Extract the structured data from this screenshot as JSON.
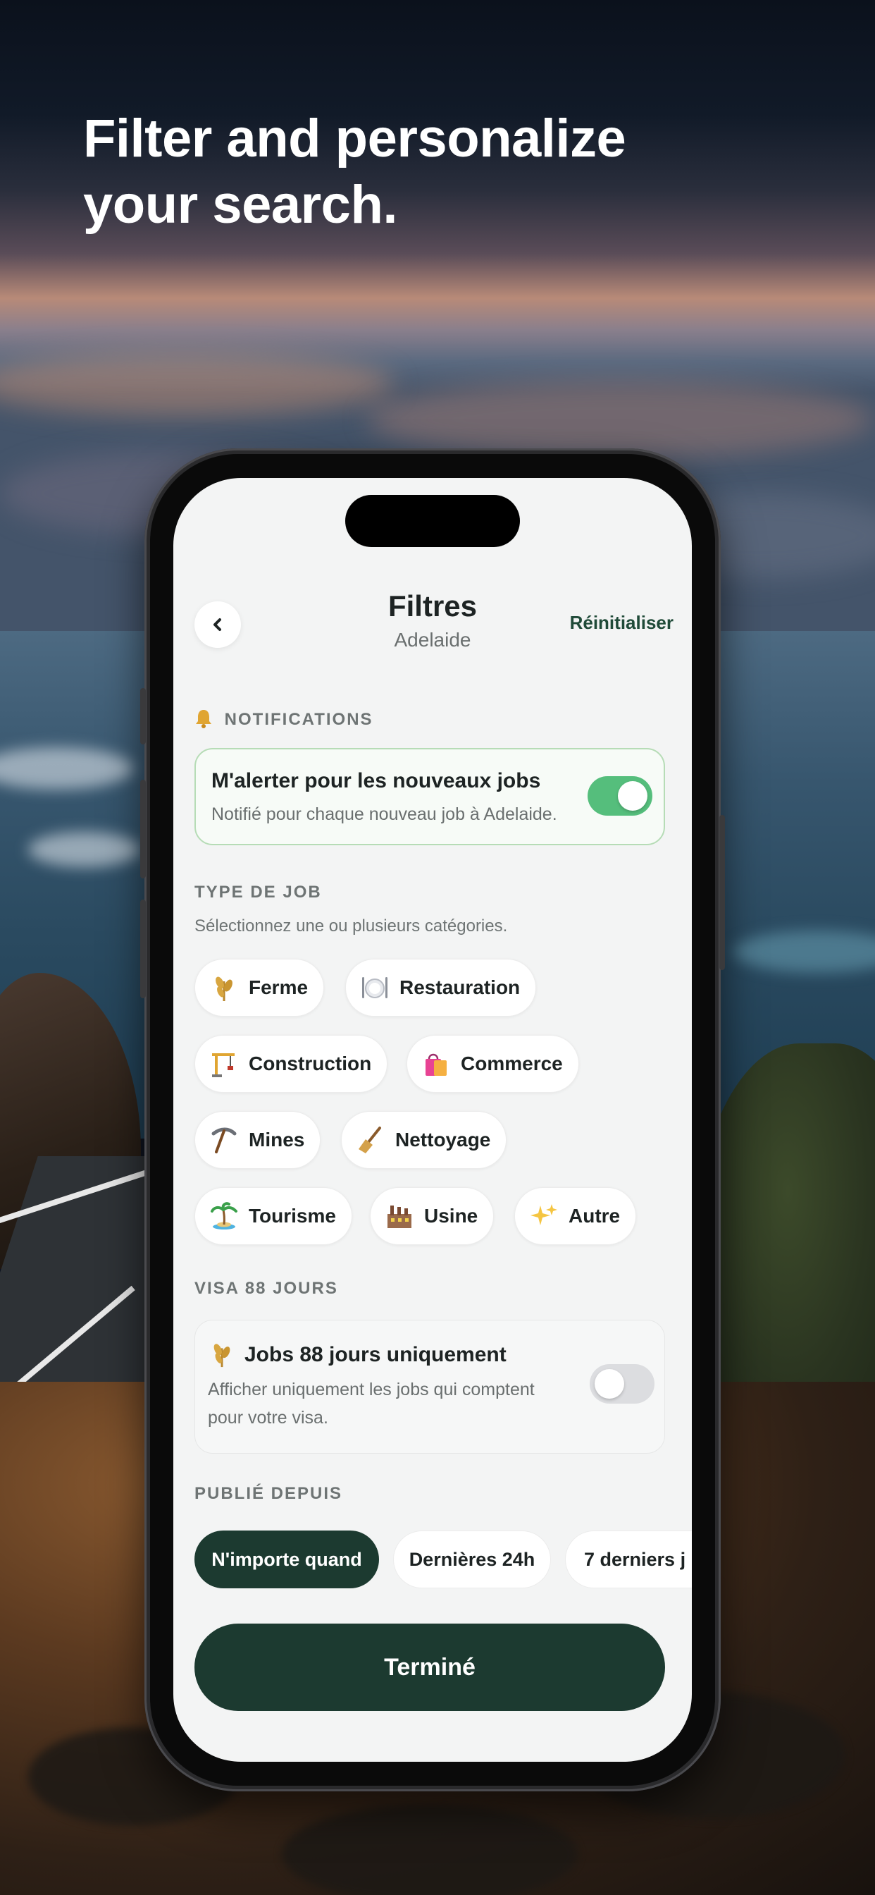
{
  "headline": {
    "line1": "Filter and personalize",
    "line2": "your search."
  },
  "header": {
    "title": "Filtres",
    "subtitle": "Adelaide",
    "reset_label": "Réinitialiser"
  },
  "notifications": {
    "section_label": "NOTIFICATIONS",
    "card_title": "M'alerter pour les nouveaux jobs",
    "card_desc": "Notifié pour chaque nouveau job à Adelaide.",
    "toggle_on": true
  },
  "job_type": {
    "section_label": "TYPE DE JOB",
    "hint": "Sélectionnez une ou plusieurs catégories.",
    "chips": [
      {
        "label": "Ferme",
        "icon": "wheat-icon"
      },
      {
        "label": "Restauration",
        "icon": "plate-cutlery-icon"
      },
      {
        "label": "Construction",
        "icon": "crane-icon"
      },
      {
        "label": "Commerce",
        "icon": "shopping-bag-icon"
      },
      {
        "label": "Mines",
        "icon": "pickaxe-icon"
      },
      {
        "label": "Nettoyage",
        "icon": "broom-icon"
      },
      {
        "label": "Tourisme",
        "icon": "palm-island-icon"
      },
      {
        "label": "Usine",
        "icon": "factory-icon"
      },
      {
        "label": "Autre",
        "icon": "sparkles-icon"
      }
    ]
  },
  "visa": {
    "section_label": "VISA 88 JOURS",
    "card_title": "Jobs 88 jours uniquement",
    "card_desc_line1": "Afficher uniquement les jobs qui comptent",
    "card_desc_line2": "pour votre visa.",
    "toggle_on": false
  },
  "published": {
    "section_label": "PUBLIÉ DEPUIS",
    "options": [
      {
        "label": "N'importe quand",
        "selected": true
      },
      {
        "label": "Dernières 24h",
        "selected": false
      },
      {
        "label": "7 derniers j",
        "selected": false
      }
    ]
  },
  "done_label": "Terminé",
  "colors": {
    "accent_dark_green": "#1c3a30",
    "toggle_green": "#55be7c",
    "reset_text": "#1f4a38"
  }
}
